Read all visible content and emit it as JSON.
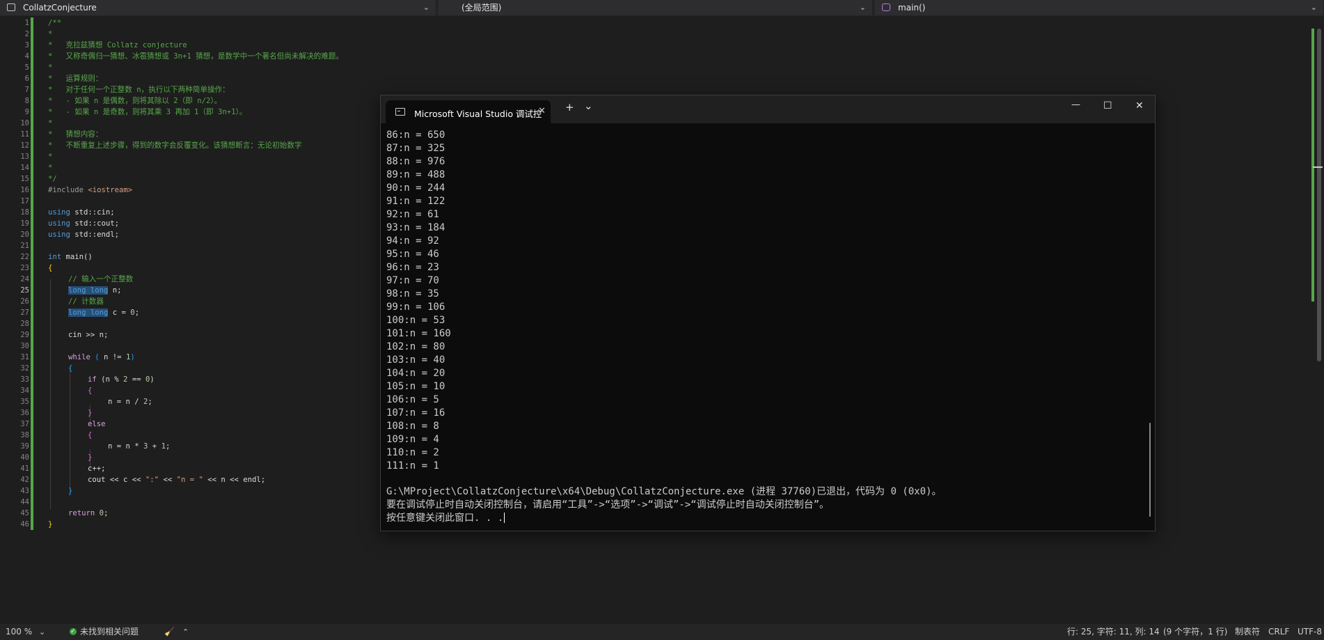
{
  "navbar": {
    "project": "CollatzConjecture",
    "scope": "(全局范围)",
    "member": "main()"
  },
  "editor": {
    "line_numbers": [
      "1",
      "2",
      "3",
      "4",
      "5",
      "6",
      "7",
      "8",
      "9",
      "10",
      "11",
      "12",
      "13",
      "14",
      "15",
      "16",
      "17",
      "18",
      "19",
      "20",
      "21",
      "22",
      "23",
      "24",
      "25",
      "26",
      "27",
      "28",
      "29",
      "30",
      "31",
      "32",
      "33",
      "34",
      "35",
      "36",
      "37",
      "38",
      "39",
      "40",
      "41",
      "42",
      "43",
      "44",
      "45",
      "46"
    ],
    "current_line": "25",
    "lines": {
      "l1": "/**",
      "l2": "*",
      "l3": "*   克拉兹猜想 Collatz conjecture",
      "l4": "*   又称奇偶归一猜想、冰雹猜想或 3n+1 猜想，是数学中一个著名但尚未解决的难题。",
      "l5": "*",
      "l6": "*   运算规则：",
      "l7": "*   对于任何一个正整数 n，执行以下两种简单操作：",
      "l8": "*   - 如果 n 是偶数，则将其除以 2（即 n/2）。",
      "l9": "*   - 如果 n 是奇数，则将其乘 3 再加 1（即 3n+1）。",
      "l10": "*",
      "l11": "*   猜想内容：",
      "l12": "*   不断重复上述步骤，得到的数字会反覆变化。该猜想断言：无论初始数字",
      "l13": "*",
      "l14": "*",
      "l15": "*/",
      "l16_pp": "#include",
      "l16_hdr": " <iostream>",
      "l18_kw": "using",
      "l18_rest": " std::cin;",
      "l19_kw": "using",
      "l19_rest": " std::cout;",
      "l20_kw": "using",
      "l20_rest": " std::endl;",
      "l22_kw": "int",
      "l22_rest": " main()",
      "l23": "{",
      "l24": "// 输入一个正整数",
      "l25_kw": "long long",
      "l25_rest": " n;",
      "l26": "// 计数器",
      "l27_kw": "long long",
      "l27_rest": " c = ",
      "l27_num": "0",
      "l27_end": ";",
      "l29": "cin >> n;",
      "l31_kw": "while",
      "l31_a": " ",
      "l31_p1": "(",
      "l31_mid": " n != ",
      "l31_num": "1",
      "l31_p2": ")",
      "l32": "{",
      "l33_kw": "if",
      "l33_rest": " (n % ",
      "l33_n1": "2",
      "l33_mid": " == ",
      "l33_n2": "0",
      "l33_end": ")",
      "l34": "{",
      "l35": "n = n / ",
      "l35_num": "2",
      "l35_end": ";",
      "l36": "}",
      "l37": "else",
      "l38": "{",
      "l39": "n = n * ",
      "l39_n1": "3",
      "l39_mid": " + ",
      "l39_n2": "1",
      "l39_end": ";",
      "l40": "}",
      "l41": "c++;",
      "l42_a": "cout << c << ",
      "l42_s1": "\":\"",
      "l42_b": " << ",
      "l42_s2": "\"n = \"",
      "l42_c": " << n << endl;",
      "l43": "}",
      "l45_kw": "return",
      "l45_rest": " ",
      "l45_num": "0",
      "l45_end": ";",
      "l46": "}"
    }
  },
  "console": {
    "title": "Microsoft Visual Studio 调试控",
    "add_tab": "+",
    "dropdown": "⌄",
    "minimize": "—",
    "maximize": "☐",
    "close": "✕",
    "tab_close": "✕",
    "output": [
      "86:n = 650",
      "87:n = 325",
      "88:n = 976",
      "89:n = 488",
      "90:n = 244",
      "91:n = 122",
      "92:n = 61",
      "93:n = 184",
      "94:n = 92",
      "95:n = 46",
      "96:n = 23",
      "97:n = 70",
      "98:n = 35",
      "99:n = 106",
      "100:n = 53",
      "101:n = 160",
      "102:n = 80",
      "103:n = 40",
      "104:n = 20",
      "105:n = 10",
      "106:n = 5",
      "107:n = 16",
      "108:n = 8",
      "109:n = 4",
      "110:n = 2",
      "111:n = 1"
    ],
    "exit_message": "G:\\MProject\\CollatzConjecture\\x64\\Debug\\CollatzConjecture.exe (进程 37760)已退出，代码为 0 (0x0)。",
    "hint_message": "要在调试停止时自动关闭控制台，请启用“工具”->“选项”->“调试”->“调试停止时自动关闭控制台”。",
    "press_key": "按任意键关闭此窗口. . ."
  },
  "statusbar": {
    "zoom": "100 %",
    "issues": "未找到相关问题",
    "position": "行: 25, 字符: 11, 列: 14",
    "selection": "(9 个字符，1 行)",
    "indent": "制表符",
    "line_ending": "CRLF",
    "encoding": "UTF-8"
  },
  "colors": {
    "comment": "#57a64a",
    "keyword": "#569cd6",
    "control_keyword": "#d8a0df",
    "number": "#b5cea8",
    "string": "#d69d85",
    "selection": "#264f78",
    "console_bg": "#0c0c0c"
  }
}
